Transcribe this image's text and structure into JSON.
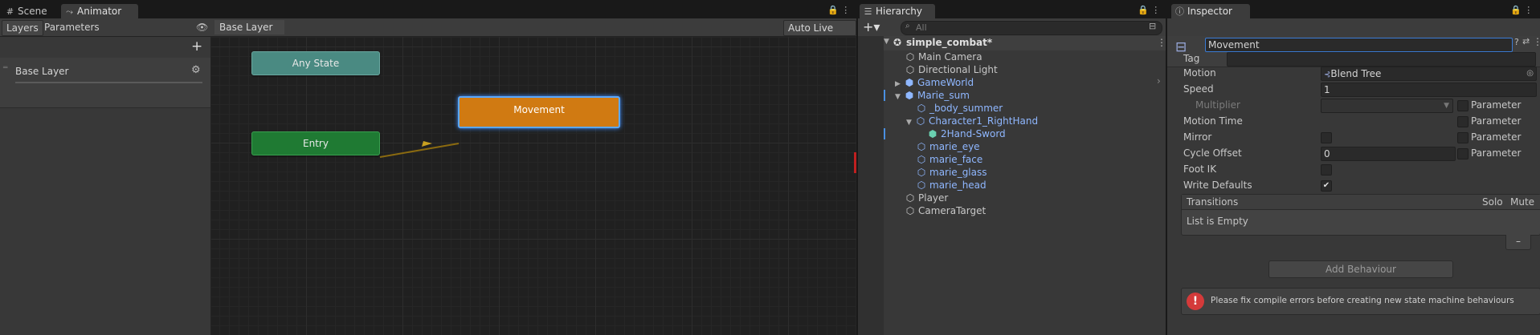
{
  "tabs": {
    "scene": "Scene",
    "animator": "Animator",
    "hierarchy": "Hierarchy",
    "inspector": "Inspector"
  },
  "animator": {
    "layers_tab": "Layers",
    "parameters_tab": "Parameters",
    "breadcrumb": "Base Layer",
    "auto_live_link": "Auto Live Link",
    "layer_name": "Base Layer",
    "nodes": {
      "any_state": "Any State",
      "entry": "Entry",
      "movement": "Movement"
    },
    "colors": {
      "any_state": "#4a8a82",
      "entry": "#1f7a33",
      "movement": "#d07a12",
      "selection": "#5aa8ff",
      "transition": "#8a6a10"
    }
  },
  "hierarchy": {
    "search_placeholder": "All",
    "scene_name": "simple_combat*",
    "items": [
      {
        "label": "Main Camera"
      },
      {
        "label": "Directional Light"
      },
      {
        "label": "GameWorld"
      },
      {
        "label": "Marie_sum"
      },
      {
        "label": "_body_summer"
      },
      {
        "label": "Character1_RightHand"
      },
      {
        "label": "2Hand-Sword"
      },
      {
        "label": "marie_eye"
      },
      {
        "label": "marie_face"
      },
      {
        "label": "marie_glass"
      },
      {
        "label": "marie_head"
      },
      {
        "label": "Player"
      },
      {
        "label": "CameraTarget"
      }
    ]
  },
  "inspector": {
    "name_value": "Movement",
    "tag_label": "Tag",
    "fields": {
      "motion_label": "Motion",
      "motion_value": "Blend Tree",
      "speed_label": "Speed",
      "speed_value": "1",
      "multiplier_label": "Multiplier",
      "motion_time_label": "Motion Time",
      "mirror_label": "Mirror",
      "cycle_offset_label": "Cycle Offset",
      "cycle_offset_value": "0",
      "foot_ik_label": "Foot IK",
      "write_defaults_label": "Write Defaults",
      "parameter_label": "Parameter"
    },
    "transitions": {
      "header": "Transitions",
      "solo": "Solo",
      "mute": "Mute",
      "empty": "List is Empty",
      "remove": "–"
    },
    "add_behaviour": "Add Behaviour",
    "warning": "Please fix compile errors before creating new state machine behaviours"
  }
}
